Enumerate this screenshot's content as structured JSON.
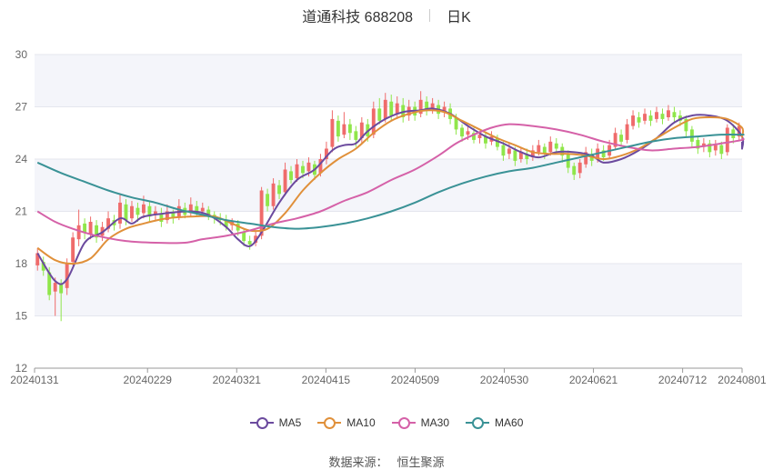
{
  "title": {
    "name": "道通科技 688208",
    "period": "日K"
  },
  "source": {
    "label": "数据来源：",
    "value": "恒生聚源"
  },
  "colors": {
    "up": "#ef6b6b",
    "down": "#8fe64a",
    "band": "#f4f5fa",
    "grid": "#e4e6ee",
    "axis_text": "#666666"
  },
  "chart_data": {
    "type": "candlestick",
    "yaxis": {
      "min": 12,
      "max": 30,
      "ticks": [
        12,
        15,
        18,
        21,
        24,
        27,
        30
      ]
    },
    "xaxis": {
      "tick_labels": [
        "20240131",
        "20240229",
        "20240321",
        "20240415",
        "20240509",
        "20240530",
        "20240621",
        "20240712",
        "20240801"
      ],
      "tick_index": [
        0,
        19,
        34,
        49,
        64,
        79,
        94,
        109,
        120
      ]
    },
    "legend_position": "bottom",
    "grid": true,
    "candles": [
      [
        17.9,
        18.6,
        18.9,
        17.6
      ],
      [
        18.1,
        17.6,
        18.4,
        17.3
      ],
      [
        17.5,
        16.2,
        17.8,
        15.9
      ],
      [
        16.4,
        16.9,
        17.2,
        15.0
      ],
      [
        16.8,
        16.3,
        17.1,
        14.7
      ],
      [
        16.6,
        18.0,
        18.3,
        16.2
      ],
      [
        18.1,
        19.5,
        19.8,
        17.9
      ],
      [
        19.4,
        20.2,
        21.1,
        19.0
      ],
      [
        20.3,
        19.8,
        20.6,
        19.4
      ],
      [
        19.7,
        20.4,
        20.7,
        19.4
      ],
      [
        20.2,
        19.5,
        20.5,
        19.2
      ],
      [
        19.6,
        20.1,
        20.4,
        19.3
      ],
      [
        20.0,
        20.6,
        21.0,
        19.8
      ],
      [
        20.5,
        20.2,
        20.8,
        19.9
      ],
      [
        20.3,
        21.5,
        22.0,
        20.0
      ],
      [
        21.4,
        20.5,
        21.7,
        20.2
      ],
      [
        20.6,
        21.3,
        21.6,
        20.4
      ],
      [
        21.2,
        20.8,
        21.5,
        20.4
      ],
      [
        20.9,
        21.4,
        21.9,
        20.6
      ],
      [
        21.3,
        20.7,
        21.6,
        20.4
      ],
      [
        20.8,
        21.0,
        21.3,
        20.5
      ],
      [
        20.9,
        20.4,
        21.2,
        20.1
      ],
      [
        20.5,
        21.0,
        21.4,
        20.3
      ],
      [
        20.9,
        20.6,
        21.1,
        20.3
      ],
      [
        20.7,
        21.3,
        21.7,
        20.5
      ],
      [
        21.2,
        20.8,
        21.5,
        20.6
      ],
      [
        20.9,
        21.4,
        21.8,
        20.7
      ],
      [
        21.3,
        20.9,
        21.6,
        20.7
      ],
      [
        21.0,
        21.2,
        21.5,
        20.8
      ],
      [
        21.1,
        20.7,
        21.3,
        20.5
      ],
      [
        20.8,
        20.6,
        21.0,
        20.3
      ],
      [
        20.6,
        20.5,
        20.9,
        20.2
      ],
      [
        20.5,
        20.1,
        20.8,
        19.9
      ],
      [
        20.2,
        20.4,
        20.6,
        19.9
      ],
      [
        20.3,
        19.9,
        20.5,
        19.6
      ],
      [
        19.8,
        19.3,
        20.0,
        19.0
      ],
      [
        19.3,
        19.1,
        19.6,
        18.8
      ],
      [
        19.2,
        19.6,
        19.9,
        19.0
      ],
      [
        19.6,
        22.2,
        22.4,
        19.4
      ],
      [
        22.0,
        21.3,
        22.3,
        21.0
      ],
      [
        21.3,
        22.6,
        22.9,
        21.1
      ],
      [
        22.5,
        22.0,
        22.8,
        21.7
      ],
      [
        22.1,
        23.4,
        23.8,
        21.9
      ],
      [
        23.3,
        22.8,
        23.6,
        22.6
      ],
      [
        22.9,
        23.7,
        24.0,
        22.7
      ],
      [
        23.6,
        23.2,
        23.9,
        22.9
      ],
      [
        23.3,
        23.8,
        24.1,
        23.0
      ],
      [
        23.7,
        23.1,
        23.9,
        22.8
      ],
      [
        23.2,
        24.0,
        24.3,
        23.0
      ],
      [
        24.0,
        24.6,
        25.0,
        23.7
      ],
      [
        24.7,
        26.3,
        26.8,
        24.4
      ],
      [
        26.2,
        25.3,
        26.5,
        25.0
      ],
      [
        25.4,
        26.0,
        26.7,
        25.2
      ],
      [
        26.0,
        25.5,
        26.3,
        25.1
      ],
      [
        25.6,
        25.1,
        25.9,
        24.7
      ],
      [
        25.2,
        26.1,
        26.4,
        24.9
      ],
      [
        26.0,
        25.3,
        26.3,
        25.0
      ],
      [
        25.4,
        26.9,
        27.3,
        25.2
      ],
      [
        26.9,
        26.2,
        27.5,
        26.0
      ],
      [
        26.3,
        27.4,
        27.8,
        26.1
      ],
      [
        27.3,
        26.5,
        27.7,
        26.2
      ],
      [
        26.6,
        27.2,
        27.6,
        26.3
      ],
      [
        27.1,
        26.4,
        27.5,
        26.1
      ],
      [
        26.5,
        27.0,
        27.4,
        26.2
      ],
      [
        27.0,
        26.5,
        27.3,
        26.2
      ],
      [
        26.6,
        27.4,
        27.9,
        26.4
      ],
      [
        27.3,
        26.8,
        27.6,
        26.5
      ],
      [
        26.9,
        27.2,
        27.5,
        26.6
      ],
      [
        27.1,
        26.6,
        27.4,
        26.3
      ],
      [
        26.7,
        27.0,
        27.3,
        26.4
      ],
      [
        26.9,
        26.3,
        27.2,
        26.0
      ],
      [
        26.4,
        25.7,
        26.6,
        25.4
      ],
      [
        25.8,
        25.3,
        26.0,
        25.0
      ],
      [
        25.4,
        25.6,
        25.9,
        25.1
      ],
      [
        25.5,
        25.1,
        25.8,
        24.9
      ],
      [
        25.2,
        25.4,
        25.6,
        24.9
      ],
      [
        25.3,
        24.9,
        25.5,
        24.6
      ],
      [
        25.0,
        25.3,
        25.6,
        24.8
      ],
      [
        25.2,
        24.7,
        25.4,
        24.5
      ],
      [
        24.8,
        24.2,
        25.0,
        23.9
      ],
      [
        24.3,
        24.6,
        24.9,
        24.0
      ],
      [
        24.5,
        23.9,
        24.7,
        23.6
      ],
      [
        24.0,
        24.4,
        24.7,
        23.8
      ],
      [
        24.3,
        24.0,
        24.6,
        23.7
      ],
      [
        24.1,
        24.5,
        24.8,
        23.9
      ],
      [
        24.4,
        24.8,
        25.1,
        24.2
      ],
      [
        24.7,
        24.3,
        24.9,
        24.0
      ],
      [
        24.4,
        25.0,
        25.3,
        24.2
      ],
      [
        24.9,
        24.6,
        25.2,
        24.3
      ],
      [
        24.7,
        24.2,
        24.9,
        23.8
      ],
      [
        24.3,
        23.5,
        24.5,
        23.2
      ],
      [
        23.6,
        23.1,
        23.8,
        22.8
      ],
      [
        23.2,
        23.8,
        24.0,
        22.9
      ],
      [
        23.7,
        24.4,
        24.7,
        23.5
      ],
      [
        24.3,
        23.9,
        24.6,
        23.6
      ],
      [
        24.0,
        24.6,
        24.9,
        23.8
      ],
      [
        24.5,
        24.1,
        24.8,
        23.9
      ],
      [
        24.2,
        24.8,
        25.1,
        24.0
      ],
      [
        24.7,
        25.5,
        25.8,
        24.5
      ],
      [
        25.4,
        25.0,
        25.7,
        24.7
      ],
      [
        25.1,
        26.0,
        26.3,
        24.9
      ],
      [
        25.9,
        26.5,
        26.8,
        25.7
      ],
      [
        26.4,
        26.1,
        26.7,
        25.8
      ],
      [
        26.2,
        26.6,
        26.9,
        26.0
      ],
      [
        26.5,
        26.2,
        26.8,
        25.9
      ],
      [
        26.3,
        26.7,
        27.0,
        26.1
      ],
      [
        26.6,
        26.3,
        26.9,
        26.0
      ],
      [
        26.4,
        26.8,
        27.1,
        26.2
      ],
      [
        26.7,
        26.4,
        27.0,
        26.1
      ],
      [
        26.5,
        26.2,
        26.8,
        25.9
      ],
      [
        26.3,
        25.6,
        26.5,
        25.3
      ],
      [
        25.7,
        25.0,
        25.9,
        24.7
      ],
      [
        25.1,
        24.6,
        25.3,
        24.3
      ],
      [
        24.7,
        24.9,
        25.2,
        24.4
      ],
      [
        24.9,
        24.4,
        25.1,
        24.1
      ],
      [
        24.5,
        24.8,
        25.1,
        24.2
      ],
      [
        24.8,
        24.3,
        25.0,
        24.0
      ],
      [
        24.4,
        25.8,
        26.0,
        24.2
      ],
      [
        25.7,
        25.2,
        26.0,
        24.9
      ],
      [
        25.3,
        25.9,
        26.1,
        25.1
      ]
    ],
    "ma_series": [
      {
        "name": "MA5",
        "color": "#6b4a9e",
        "points": [
          [
            0,
            18.6
          ],
          [
            3,
            17.0
          ],
          [
            5,
            17.1
          ],
          [
            8,
            19.2
          ],
          [
            11,
            19.8
          ],
          [
            14,
            20.6
          ],
          [
            16,
            20.3
          ],
          [
            18,
            20.7
          ],
          [
            22,
            20.9
          ],
          [
            26,
            21.0
          ],
          [
            29,
            20.8
          ],
          [
            32,
            20.1
          ],
          [
            34,
            19.4
          ],
          [
            36,
            19.0
          ],
          [
            38,
            19.8
          ],
          [
            41,
            21.5
          ],
          [
            44,
            22.8
          ],
          [
            47,
            23.4
          ],
          [
            50,
            24.5
          ],
          [
            52,
            24.8
          ],
          [
            54,
            24.9
          ],
          [
            56,
            25.6
          ],
          [
            59,
            26.3
          ],
          [
            62,
            26.7
          ],
          [
            65,
            26.8
          ],
          [
            67,
            26.9
          ],
          [
            70,
            26.6
          ],
          [
            73,
            25.9
          ],
          [
            76,
            25.3
          ],
          [
            79,
            24.9
          ],
          [
            82,
            24.4
          ],
          [
            85,
            24.1
          ],
          [
            88,
            24.4
          ],
          [
            91,
            24.4
          ],
          [
            94,
            24.2
          ],
          [
            96,
            23.8
          ],
          [
            99,
            24.0
          ],
          [
            102,
            24.5
          ],
          [
            105,
            25.2
          ],
          [
            108,
            26.1
          ],
          [
            111,
            26.5
          ],
          [
            114,
            26.5
          ],
          [
            117,
            26.2
          ],
          [
            120,
            25.3
          ],
          [
            123,
            24.6
          ],
          [
            126,
            25.0
          ]
        ]
      },
      {
        "name": "MA10",
        "color": "#e0903a",
        "points": [
          [
            0,
            18.9
          ],
          [
            3,
            18.2
          ],
          [
            6,
            18.0
          ],
          [
            9,
            18.3
          ],
          [
            12,
            19.4
          ],
          [
            15,
            20.0
          ],
          [
            18,
            20.3
          ],
          [
            22,
            20.6
          ],
          [
            26,
            20.7
          ],
          [
            30,
            20.7
          ],
          [
            33,
            20.3
          ],
          [
            36,
            19.9
          ],
          [
            39,
            20.0
          ],
          [
            42,
            20.9
          ],
          [
            45,
            22.2
          ],
          [
            48,
            23.2
          ],
          [
            51,
            24.0
          ],
          [
            54,
            24.6
          ],
          [
            57,
            25.5
          ],
          [
            60,
            26.2
          ],
          [
            63,
            26.6
          ],
          [
            66,
            26.8
          ],
          [
            69,
            26.7
          ],
          [
            72,
            26.2
          ],
          [
            75,
            25.7
          ],
          [
            78,
            25.2
          ],
          [
            81,
            24.8
          ],
          [
            84,
            24.4
          ],
          [
            87,
            24.3
          ],
          [
            90,
            24.3
          ],
          [
            93,
            24.2
          ],
          [
            96,
            24.0
          ],
          [
            99,
            24.2
          ],
          [
            102,
            24.6
          ],
          [
            105,
            25.2
          ],
          [
            108,
            25.8
          ],
          [
            111,
            26.3
          ],
          [
            114,
            26.4
          ],
          [
            117,
            26.3
          ],
          [
            120,
            25.8
          ],
          [
            123,
            25.3
          ],
          [
            126,
            25.3
          ]
        ]
      },
      {
        "name": "MA30",
        "color": "#d561a8",
        "points": [
          [
            0,
            21.0
          ],
          [
            3,
            20.4
          ],
          [
            6,
            20.0
          ],
          [
            10,
            19.6
          ],
          [
            15,
            19.3
          ],
          [
            20,
            19.2
          ],
          [
            25,
            19.2
          ],
          [
            28,
            19.4
          ],
          [
            32,
            19.6
          ],
          [
            36,
            19.9
          ],
          [
            40,
            20.3
          ],
          [
            44,
            20.6
          ],
          [
            48,
            21.0
          ],
          [
            52,
            21.6
          ],
          [
            56,
            22.1
          ],
          [
            60,
            22.8
          ],
          [
            64,
            23.4
          ],
          [
            68,
            24.2
          ],
          [
            71,
            24.9
          ],
          [
            74,
            25.4
          ],
          [
            77,
            25.8
          ],
          [
            80,
            26.0
          ],
          [
            84,
            25.9
          ],
          [
            88,
            25.7
          ],
          [
            92,
            25.4
          ],
          [
            96,
            25.0
          ],
          [
            100,
            24.7
          ],
          [
            104,
            24.5
          ],
          [
            108,
            24.6
          ],
          [
            112,
            24.7
          ],
          [
            116,
            24.9
          ],
          [
            120,
            25.1
          ],
          [
            126,
            25.2
          ]
        ]
      },
      {
        "name": "MA60",
        "color": "#3a9296",
        "points": [
          [
            0,
            23.8
          ],
          [
            4,
            23.2
          ],
          [
            8,
            22.7
          ],
          [
            12,
            22.2
          ],
          [
            16,
            21.8
          ],
          [
            20,
            21.5
          ],
          [
            24,
            21.1
          ],
          [
            28,
            20.8
          ],
          [
            32,
            20.5
          ],
          [
            36,
            20.3
          ],
          [
            40,
            20.1
          ],
          [
            44,
            20.0
          ],
          [
            48,
            20.1
          ],
          [
            52,
            20.3
          ],
          [
            56,
            20.6
          ],
          [
            60,
            21.0
          ],
          [
            64,
            21.5
          ],
          [
            68,
            22.1
          ],
          [
            72,
            22.6
          ],
          [
            76,
            23.0
          ],
          [
            80,
            23.3
          ],
          [
            84,
            23.5
          ],
          [
            88,
            23.8
          ],
          [
            92,
            24.1
          ],
          [
            96,
            24.4
          ],
          [
            100,
            24.7
          ],
          [
            104,
            25.0
          ],
          [
            108,
            25.2
          ],
          [
            112,
            25.3
          ],
          [
            116,
            25.4
          ],
          [
            120,
            25.4
          ],
          [
            126,
            25.4
          ]
        ]
      }
    ]
  },
  "legend": [
    {
      "name": "MA5",
      "color": "#6b4a9e"
    },
    {
      "name": "MA10",
      "color": "#e0903a"
    },
    {
      "name": "MA30",
      "color": "#d561a8"
    },
    {
      "name": "MA60",
      "color": "#3a9296"
    }
  ]
}
